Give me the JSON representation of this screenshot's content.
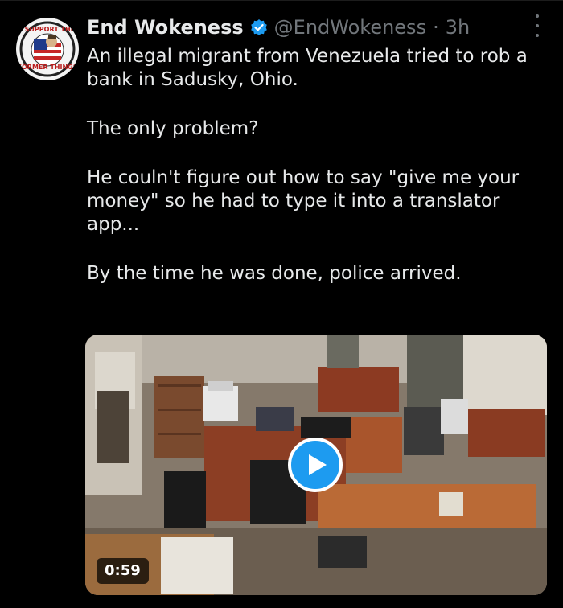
{
  "tweet": {
    "display_name": "End Wokeness",
    "handle": "@EndWokeness",
    "separator": "·",
    "time": "3h",
    "paragraphs": [
      "An illegal migrant from Venezuela tried to rob a bank in Sadusky, Ohio.",
      "The only problem?",
      "He couln't figure out how to say \"give me your money\" so he had to type it into a translator app...",
      "By the time he was done, police arrived."
    ],
    "video_duration": "0:59"
  },
  "avatar": {
    "text_top": "I SUPPORT THE",
    "text_bottom": "FORMER THINGS"
  },
  "colors": {
    "background": "#000000",
    "text": "#e7e9ea",
    "secondary": "#71767b",
    "accent": "#1d9bf0"
  },
  "icons": {
    "verified": "verified-badge-icon",
    "more": "more-vertical-icon",
    "play": "play-icon"
  }
}
